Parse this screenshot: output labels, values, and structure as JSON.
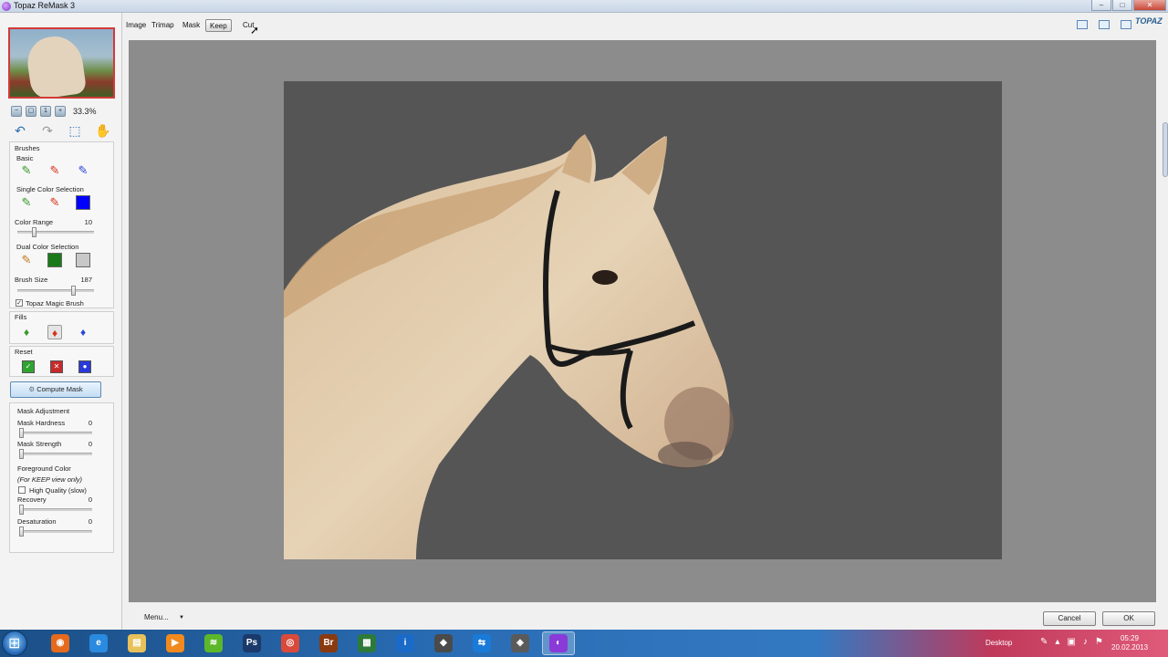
{
  "window": {
    "title": "Topaz ReMask 3",
    "controls": [
      "–",
      "□",
      "✕"
    ]
  },
  "navigator": {
    "zoom": "33.3%"
  },
  "brushes": {
    "heading": "Brushes",
    "basic_label": "Basic",
    "single_label": "Single Color Selection",
    "single_color": "#0000ff",
    "color_range_label": "Color Range",
    "color_range_value": "10",
    "color_range_level": 0.2,
    "dual_label": "Dual Color Selection",
    "dual_color_1": "#1a7a1a",
    "dual_color_2": "#c8c8c8",
    "brush_size_label": "Brush Size",
    "brush_size_value": "187",
    "brush_size_level": 0.75,
    "magic_label": "Topaz Magic Brush",
    "magic_checked": "✓",
    "fills_label": "Fills",
    "reset_label": "Reset"
  },
  "compute": {
    "label": "Compute Mask"
  },
  "adjust": {
    "heading": "Mask Adjustment",
    "hardness_label": "Mask Hardness",
    "hardness_value": "0",
    "strength_label": "Mask Strength",
    "strength_value": "0",
    "fg_label": "Foreground Color",
    "fg_note": "(For KEEP view only)",
    "hq_label": "High Quality (slow)",
    "recovery_label": "Recovery",
    "recovery_value": "0",
    "desat_label": "Desaturation",
    "desat_value": "0"
  },
  "tabs": [
    {
      "label": "Image"
    },
    {
      "label": "Trimap"
    },
    {
      "label": "Mask"
    },
    {
      "label": "Keep"
    },
    {
      "label": "Cut"
    }
  ],
  "active_tab": "Keep",
  "logo": "TOPAZ",
  "bottom": {
    "menu_label": "Menu...",
    "cancel_label": "Cancel",
    "ok_label": "OK"
  },
  "taskbar": {
    "icons": [
      {
        "name": "firefox-icon",
        "glyph": "◉",
        "color": "#e66a1e"
      },
      {
        "name": "ie-icon",
        "glyph": "e",
        "color": "#2a8ae0"
      },
      {
        "name": "explorer-icon",
        "glyph": "▤",
        "color": "#e8c15a"
      },
      {
        "name": "media-player-icon",
        "glyph": "▶",
        "color": "#f08a1e"
      },
      {
        "name": "spotify-icon",
        "glyph": "≋",
        "color": "#5cb82a"
      },
      {
        "name": "photoshop-icon",
        "glyph": "Ps",
        "color": "#1b3a6b"
      },
      {
        "name": "chrome-icon",
        "glyph": "◎",
        "color": "#d94a3a"
      },
      {
        "name": "bridge-icon",
        "glyph": "Br",
        "color": "#8a3a10"
      },
      {
        "name": "app-icon-1",
        "glyph": "▦",
        "color": "#2e7a3a"
      },
      {
        "name": "info-icon",
        "glyph": "i",
        "color": "#1a6ac8"
      },
      {
        "name": "app-icon-2",
        "glyph": "◆",
        "color": "#4a4a4a"
      },
      {
        "name": "teamviewer-icon",
        "glyph": "⇆",
        "color": "#1a7ad8"
      },
      {
        "name": "app-icon-3",
        "glyph": "◈",
        "color": "#5a5a5a"
      },
      {
        "name": "topaz-icon",
        "glyph": "◐",
        "color": "#8a3ad8"
      }
    ],
    "desktop_label": "Desktop",
    "time": "05:29",
    "date": "20.02.2013"
  }
}
